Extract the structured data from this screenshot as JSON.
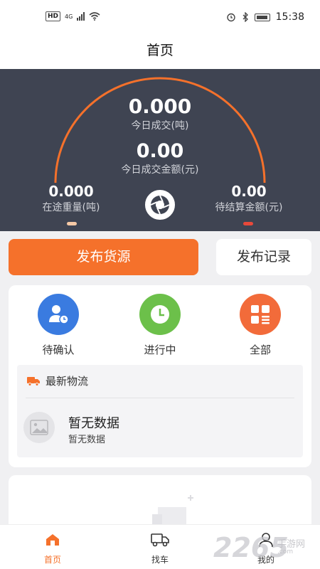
{
  "status_bar": {
    "network": "HD",
    "signal_label": "4G",
    "time": "15:38"
  },
  "header": {
    "title": "首页"
  },
  "dashboard": {
    "today_deals_value": "0.000",
    "today_deals_label": "今日成交(吨)",
    "today_amount_value": "0.00",
    "today_amount_label": "今日成交金额(元)",
    "in_transit_value": "0.000",
    "in_transit_label": "在途重量(吨)",
    "pending_value": "0.00",
    "pending_label": "待结算金额(元)",
    "arc_color": "#f5712b"
  },
  "actions": {
    "publish_label": "发布货源",
    "records_label": "发布记录"
  },
  "quick_status": [
    {
      "label": "待确认",
      "icon": "user-clock-icon",
      "color": "#3a7be0"
    },
    {
      "label": "进行中",
      "icon": "clock-icon",
      "color": "#6cc04a"
    },
    {
      "label": "全部",
      "icon": "grid-list-icon",
      "color": "#f26b3a"
    }
  ],
  "news": {
    "title": "最新物流",
    "icon": "truck-icon",
    "empty_title": "暂无数据",
    "empty_subtitle": "暂无数据"
  },
  "tabbar": {
    "items": [
      {
        "label": "首页",
        "icon": "home-icon",
        "active": true
      },
      {
        "label": "找车",
        "icon": "truck-outline-icon",
        "active": false
      },
      {
        "label": "我的",
        "icon": "person-icon",
        "active": false
      }
    ]
  },
  "watermark": {
    "text": "2265",
    "site": "手游网",
    "domain": ".com"
  },
  "colors": {
    "accent": "#f5712b",
    "dashboard_bg": "#3f4452"
  }
}
